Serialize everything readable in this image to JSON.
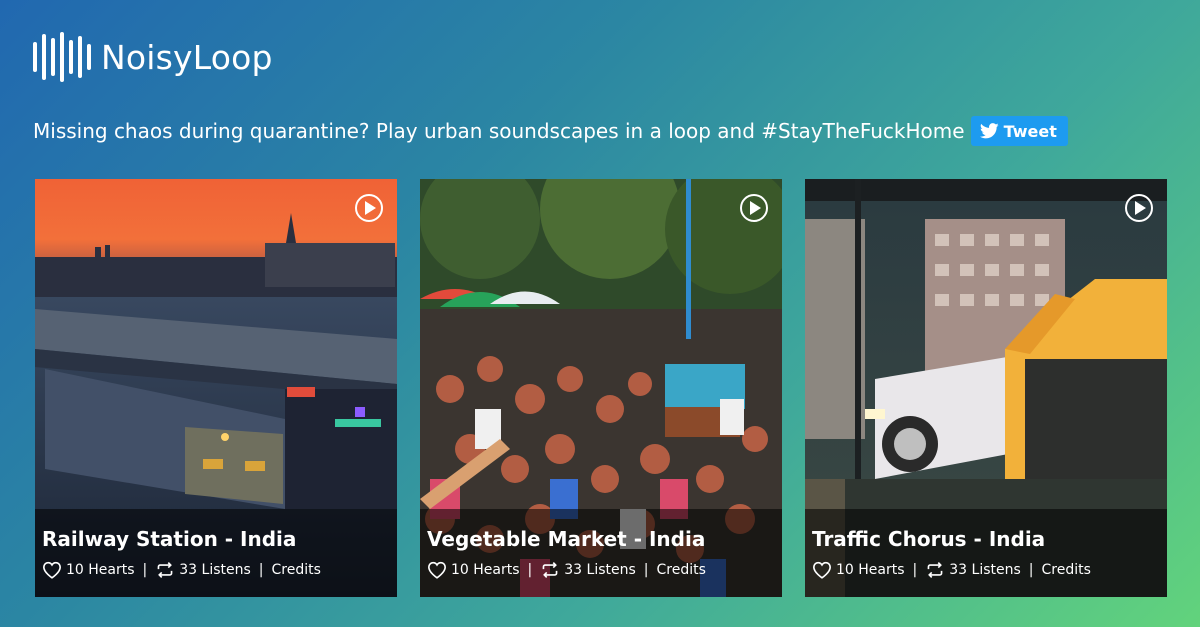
{
  "brand": {
    "name": "NoisyLoop",
    "icon": "soundwave-logo-icon"
  },
  "tagline": "Missing chaos during quarantine? Play urban soundscapes in a loop and #StayTheFuckHome",
  "tweet": {
    "label": "Tweet",
    "icon": "twitter-bird-icon",
    "color": "#1d9bf0"
  },
  "cards": [
    {
      "title": "Railway Station - India",
      "hearts": "10 Hearts",
      "listens": "33 Listens",
      "credits": "Credits"
    },
    {
      "title": "Vegetable Market - India",
      "hearts": "10 Hearts",
      "listens": "33 Listens",
      "credits": "Credits"
    },
    {
      "title": "Traffic Chorus - India",
      "hearts": "10 Hearts",
      "listens": "33 Listens",
      "credits": "Credits"
    }
  ]
}
